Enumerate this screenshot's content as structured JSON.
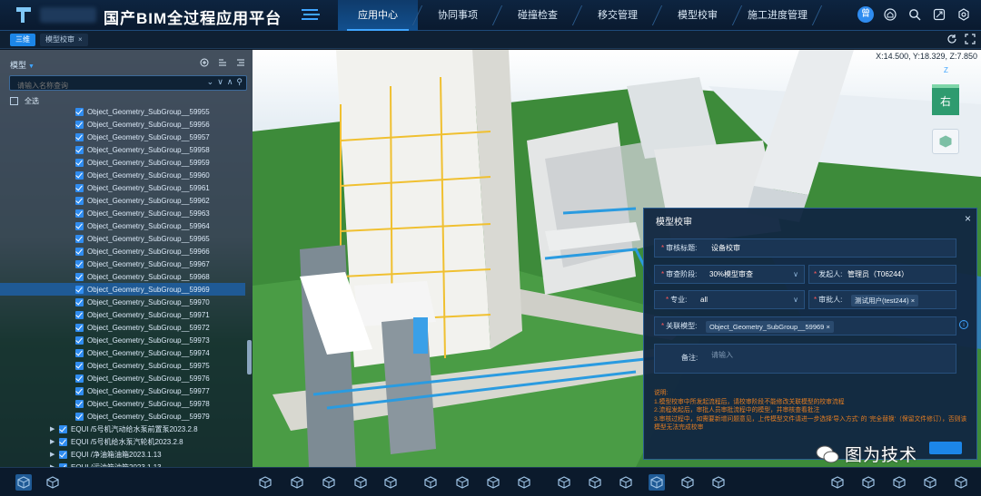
{
  "app": {
    "title": "国产BIM全过程应用平台"
  },
  "nav": {
    "tabs": [
      {
        "label": "应用中心",
        "active": true
      },
      {
        "label": "协同事项",
        "active": false
      },
      {
        "label": "碰撞检查",
        "active": false
      },
      {
        "label": "移交管理",
        "active": false
      },
      {
        "label": "模型校审",
        "active": false
      },
      {
        "label": "施工进度管理",
        "active": false
      }
    ],
    "avatar_text": "曾"
  },
  "tabs_row": {
    "primary": "三维",
    "secondary": "模型校审",
    "secondary_close": "×"
  },
  "viewport": {
    "coords": "X:14.500, Y:18.329, Z:7.850"
  },
  "panel": {
    "title": "模型",
    "search_placeholder": "请输入名称查询",
    "select_all": "全选",
    "leaf_items": [
      "Object_Geometry_SubGroup__59955",
      "Object_Geometry_SubGroup__59956",
      "Object_Geometry_SubGroup__59957",
      "Object_Geometry_SubGroup__59958",
      "Object_Geometry_SubGroup__59959",
      "Object_Geometry_SubGroup__59960",
      "Object_Geometry_SubGroup__59961",
      "Object_Geometry_SubGroup__59962",
      "Object_Geometry_SubGroup__59963",
      "Object_Geometry_SubGroup__59964",
      "Object_Geometry_SubGroup__59965",
      "Object_Geometry_SubGroup__59966",
      "Object_Geometry_SubGroup__59967",
      "Object_Geometry_SubGroup__59968",
      "Object_Geometry_SubGroup__59969",
      "Object_Geometry_SubGroup__59970",
      "Object_Geometry_SubGroup__59971",
      "Object_Geometry_SubGroup__59972",
      "Object_Geometry_SubGroup__59973",
      "Object_Geometry_SubGroup__59974",
      "Object_Geometry_SubGroup__59975",
      "Object_Geometry_SubGroup__59976",
      "Object_Geometry_SubGroup__59977",
      "Object_Geometry_SubGroup__59978",
      "Object_Geometry_SubGroup__59979"
    ],
    "group_items": [
      "EQUI /5号机汽动给水泵前置泵2023.2.8",
      "EQUI /5号机给水泵汽轮机2023.2.8",
      "EQUI /净油箱油箱2023.1.13",
      "EQUI /污油箱油箱2023.1.13"
    ]
  },
  "cube": {
    "face": "右",
    "axis_top": "Z"
  },
  "dialog": {
    "title": "模型校审",
    "close": "×",
    "review_title_label": "审核标题:",
    "review_title_value": "设备校审",
    "stage_label": "审查阶段:",
    "stage_value": "30%模型审查",
    "initiator_label": "发起人:",
    "initiator_value": "管理员（T06244）",
    "discipline_label": "专业:",
    "discipline_value": "all",
    "reviewer_label": "审批人:",
    "reviewer_value": "测试用户(test244)",
    "model_label": "关联模型:",
    "model_value": "Object_Geometry_SubGroup__59969",
    "remark_label": "备注:",
    "remark_placeholder": "请输入",
    "notes": [
      "说明:",
      "1.模型校审中所发起流程后，请校审阶段不能修改关联模型的校审流程",
      "2.流程发起后，审批人员审批流程中的模型，并审核查看批注",
      "3.审核过程中，如需要新增问题意见，上传模型文件请进一步选择'导入方式' 的 '完全替换'（保留文件修订），否则该模型无法完成校审"
    ]
  },
  "watermark": {
    "text": "图为技术"
  }
}
